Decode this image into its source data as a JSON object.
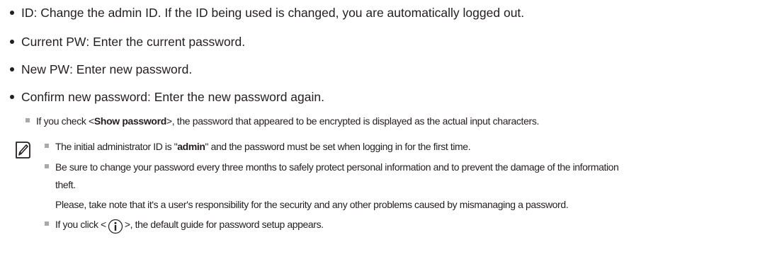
{
  "bullets": [
    {
      "label": "ID",
      "text": " : Change the admin ID. If the ID being used is changed, you are automatically logged out."
    },
    {
      "label": "Current PW",
      "text": " : Enter the current password."
    },
    {
      "label": "New PW",
      "text": " : Enter new password."
    },
    {
      "label": "Confirm new password",
      "text": " : Enter the new password again."
    }
  ],
  "sub_note": {
    "prefix": "If you check <",
    "bold": "Show password",
    "suffix": ">, the password that appeared to be encrypted is displayed as the actual input characters."
  },
  "note_icon": "pencil-note-icon",
  "notes": {
    "admin": {
      "prefix": "The initial administrator ID is \"",
      "bold": "admin",
      "suffix": "\" and the password must be set when logging in for the first time."
    },
    "change_line1": "Be sure to change your password every three months to safely protect personal information and to prevent the damage of the information",
    "change_line2": "theft.",
    "change_line3": "Please, take note that it's a user's responsibility for the security and any other problems caused by mismanaging a password.",
    "info": {
      "prefix": "If you click <",
      "icon": "info-icon",
      "suffix": ">, the default guide for password setup appears."
    }
  },
  "colors": {
    "text": "#231f20",
    "square_bullet": "#a7a9ac"
  }
}
